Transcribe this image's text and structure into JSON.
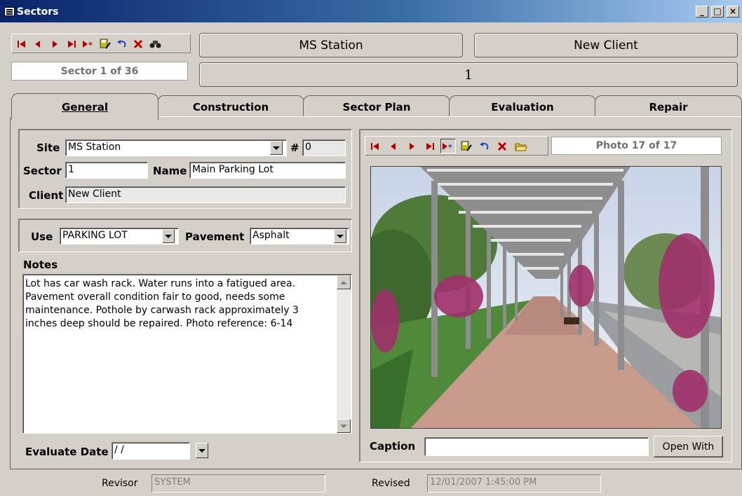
{
  "window": {
    "title": "Sectors",
    "controls": [
      "_",
      "□",
      "×"
    ]
  },
  "nav_toolbar": {
    "buttons": [
      "first",
      "previous",
      "next",
      "last",
      "new",
      "save",
      "undo",
      "delete",
      "find"
    ]
  },
  "header": {
    "site_name": "MS Station",
    "client_name": "New Client",
    "record_counter": "Sector 1 of 36",
    "sector_number": "1"
  },
  "tabs": [
    {
      "label": "General",
      "active": true
    },
    {
      "label": "Construction",
      "active": false
    },
    {
      "label": "Sector Plan",
      "active": false
    },
    {
      "label": "Evaluation",
      "active": false
    },
    {
      "label": "Repair",
      "active": false
    }
  ],
  "general": {
    "site_label": "Site",
    "site_value": "MS Station",
    "hash_label": "#",
    "hash_value": "0",
    "sector_label": "Sector",
    "sector_value": "1",
    "name_label": "Name",
    "name_value": "Main Parking Lot",
    "client_label": "Client",
    "client_value": "New Client",
    "use_label": "Use",
    "use_value": "PARKING LOT",
    "pavement_label": "Pavement",
    "pavement_value": "Asphalt",
    "notes_label": "Notes",
    "notes_value": "Lot has car wash rack. Water runs into a fatigued area.\nPavement overall condition fair to good, needs some\nmaintenance. Pothole by carwash rack approximately 3\ninches deep should be repaired. Photo reference: 6-14",
    "evaluate_date_label": "Evaluate Date",
    "evaluate_date_value": " /  /"
  },
  "photo": {
    "counter": "Photo 17 of 17",
    "caption_label": "Caption",
    "caption_value": "",
    "open_with_label": "Open With"
  },
  "status": {
    "revisor_label": "Revisor",
    "revisor_value": "SYSTEM",
    "revised_label": "Revised",
    "revised_value": "12/01/2007 1:45:00 PM"
  },
  "colors": {
    "title_gradient_start": "#0a246a",
    "nav_icon": "#b00000",
    "window_bg": "#d4d0c8"
  }
}
